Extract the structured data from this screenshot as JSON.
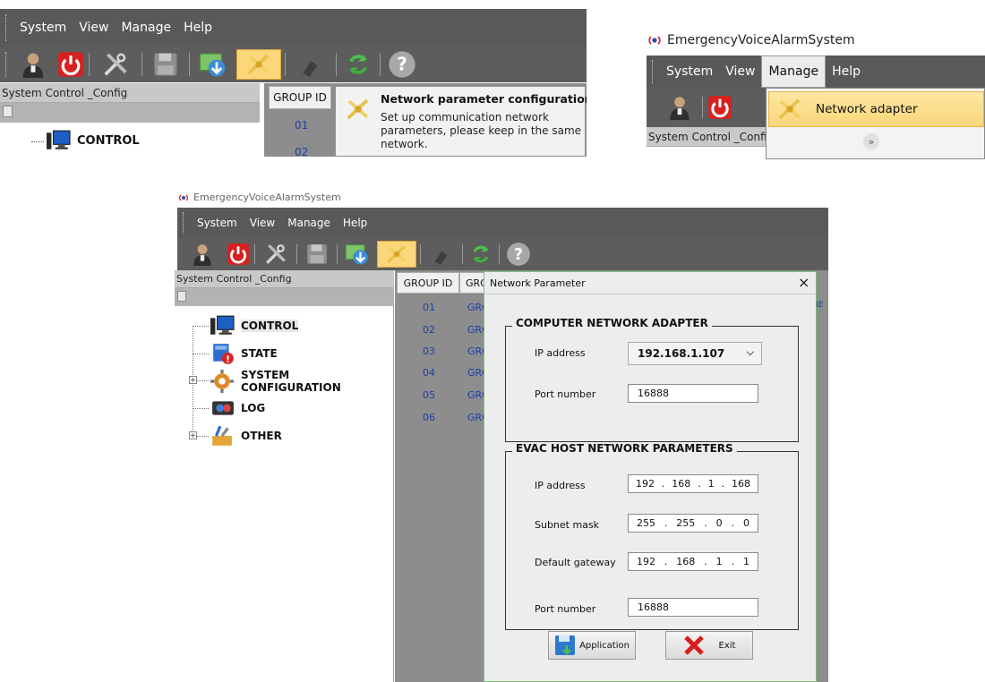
{
  "app": {
    "title": "EmergencyVoiceAlarmSystem"
  },
  "menu": [
    "System",
    "View",
    "Manage",
    "Help"
  ],
  "panel": {
    "header": "System Control _Config"
  },
  "tree": [
    {
      "label": "CONTROL",
      "icon": "monitor-icon"
    },
    {
      "label": "STATE",
      "icon": "state-alert-icon"
    },
    {
      "label": "SYSTEM CONFIGURATION",
      "icon": "gear-icon"
    },
    {
      "label": "LOG",
      "icon": "log-icon"
    },
    {
      "label": "OTHER",
      "icon": "tools-icon"
    }
  ],
  "grid": {
    "col1": "GROUP ID",
    "col2": "GRO",
    "ids": [
      "01",
      "02",
      "03",
      "04",
      "05",
      "06"
    ],
    "col2_values": [
      "GRO",
      "GRO",
      "GRO",
      "GRO",
      "GRO",
      "GRO"
    ],
    "overflow": "NE"
  },
  "tooltip": {
    "title": "Network parameter configuration",
    "body_lines": [
      "Set up communication network",
      "parameters, please keep in the same",
      "network."
    ]
  },
  "manage_menu": {
    "item": "Network adapter",
    "more_icon": "double-chevron-down-icon"
  },
  "dialog": {
    "title": "Network Parameter",
    "close": "×",
    "computer_group": "COMPUTER NETWORK ADAPTER",
    "ip_label": "IP address",
    "ip_value": "192.168.1.107",
    "port_label": "Port number",
    "port_value": "16888",
    "evac_group": "EVAC HOST NETWORK PARAMETERS",
    "evac_ip_label": "IP address",
    "evac_ip": [
      "192",
      "168",
      "1",
      "168"
    ],
    "mask_label": "Subnet mask",
    "mask": [
      "255",
      "255",
      "0",
      "0"
    ],
    "gw_label": "Default gateway",
    "gw": [
      "192",
      "168",
      "1",
      "1"
    ],
    "evac_port_label": "Port number",
    "evac_port_value": "16888",
    "apply_button": "Application",
    "exit_button": "Exit"
  },
  "colors": {
    "menubar": "#595959",
    "highlight": "#fbd67a",
    "dialog_border": "#7ebf7e",
    "id_blue": "#1a3fa8"
  }
}
